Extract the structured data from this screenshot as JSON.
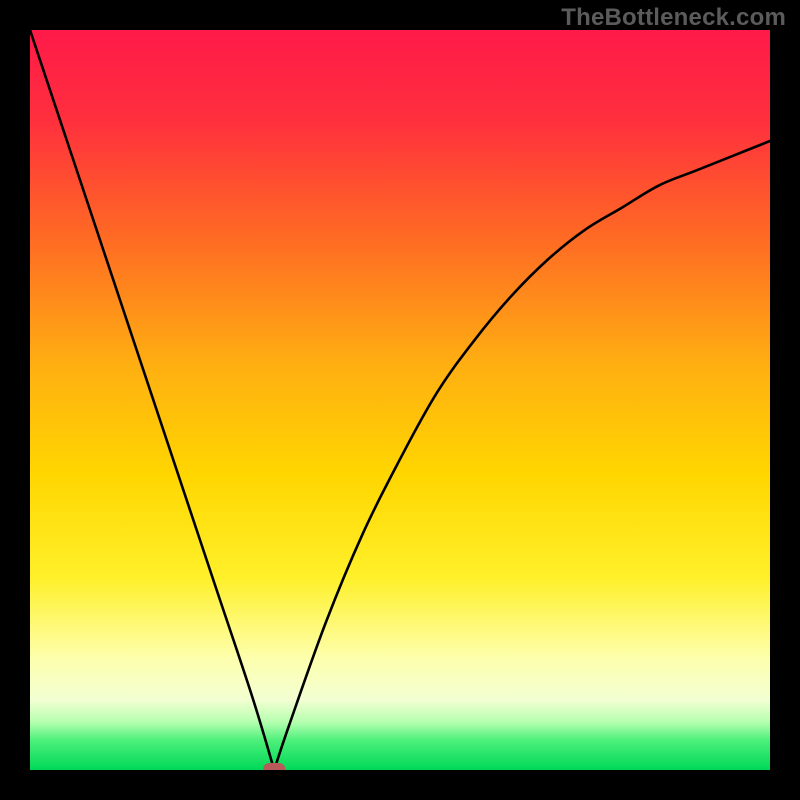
{
  "watermark": "TheBottleneck.com",
  "chart_data": {
    "type": "line",
    "title": "",
    "xlabel": "",
    "ylabel": "",
    "xlim": [
      0,
      100
    ],
    "ylim": [
      0,
      100
    ],
    "x": [
      0,
      5,
      10,
      15,
      20,
      25,
      30,
      33,
      35,
      40,
      45,
      50,
      55,
      60,
      65,
      70,
      75,
      80,
      85,
      90,
      95,
      100
    ],
    "y": [
      100,
      85,
      70,
      55,
      40,
      25,
      10,
      0,
      6,
      20,
      32,
      42,
      51,
      58,
      64,
      69,
      73,
      76,
      79,
      81,
      83,
      85
    ],
    "marker": {
      "x": 33,
      "y": 0,
      "color": "#b8595a"
    },
    "gradient_colors": {
      "top": "#ff1847",
      "mid_upper": "#ff7a1f",
      "mid": "#ffd500",
      "mid_lower": "#f7ff6e",
      "lower_band": "#d4ffb0",
      "bottom": "#00e05a"
    }
  }
}
